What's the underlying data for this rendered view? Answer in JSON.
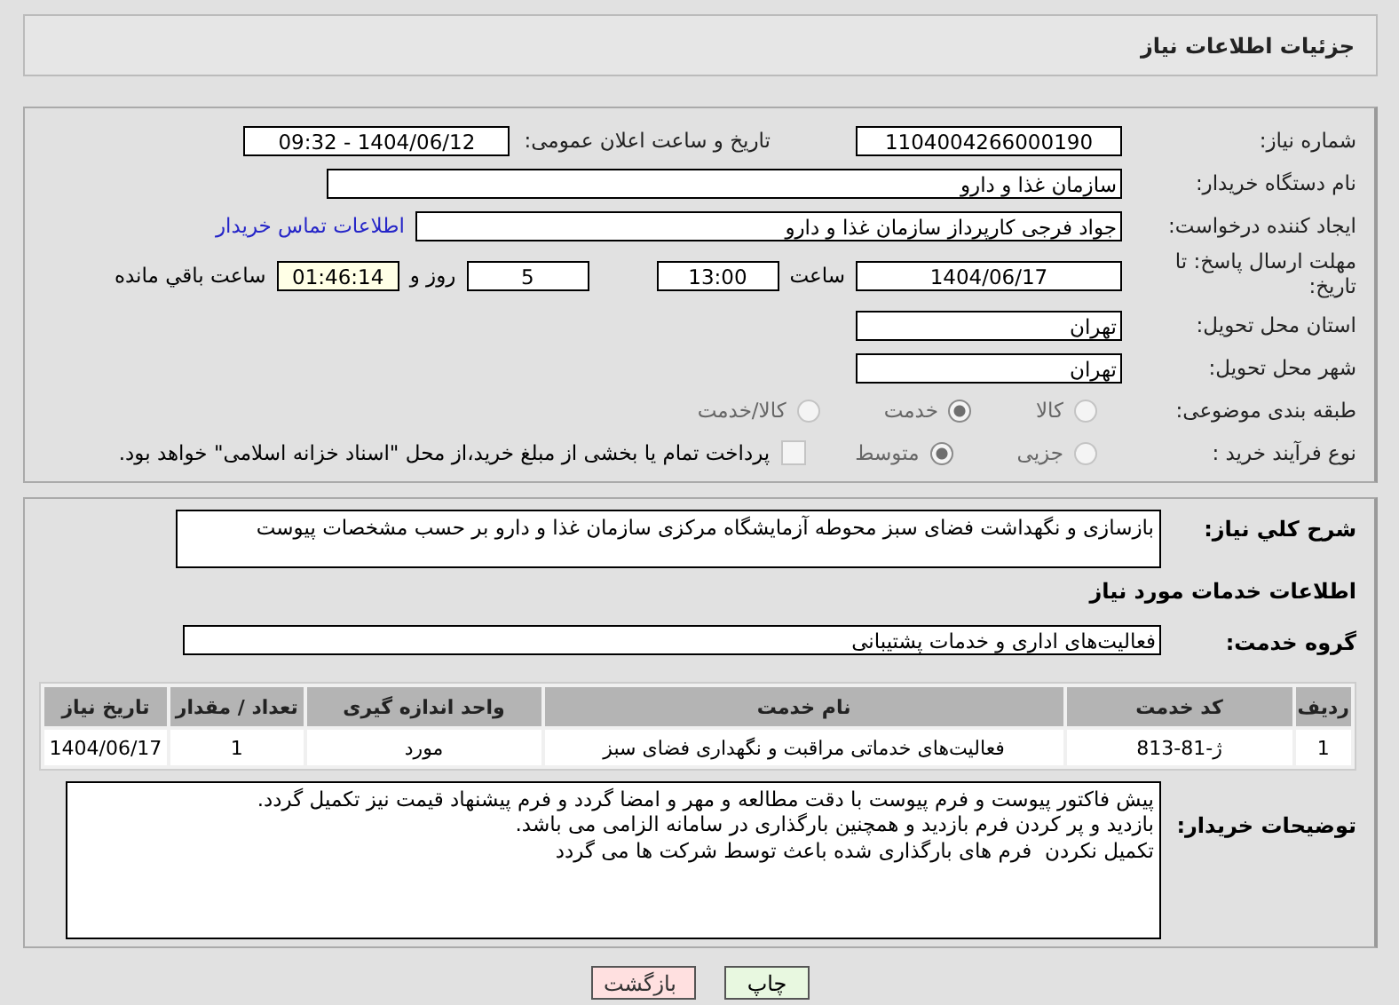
{
  "header": {
    "title": "جزئیات اطلاعات نیاز"
  },
  "details": {
    "need_number": {
      "label": "شماره نیاز:",
      "value": "1104004266000190"
    },
    "announce": {
      "label": "تاریخ و ساعت اعلان عمومی:",
      "value": "1404/06/12 - 09:32"
    },
    "buyer_org": {
      "label": "نام دستگاه خریدار:",
      "value": "سازمان غذا و دارو"
    },
    "requester": {
      "label": "ایجاد کننده درخواست:",
      "value": "جواد فرجی کارپرداز سازمان غذا و دارو"
    },
    "contact_link": "اطلاعات تماس خریدار",
    "deadline": {
      "label": "مهلت ارسال پاسخ: تا تاریخ:",
      "date": "1404/06/17",
      "time_label": "ساعت",
      "time": "13:00",
      "days": "5",
      "days_label": "روز و",
      "remaining": "01:46:14",
      "remaining_label": "ساعت باقي مانده"
    },
    "province": {
      "label": "استان محل تحویل:",
      "value": "تهران"
    },
    "city": {
      "label": "شهر محل تحویل:",
      "value": "تهران"
    },
    "category": {
      "label": "طبقه بندی موضوعی:",
      "options": [
        {
          "label": "کالا",
          "selected": false
        },
        {
          "label": "خدمت",
          "selected": true
        },
        {
          "label": "کالا/خدمت",
          "selected": false
        }
      ]
    },
    "process": {
      "label": "نوع فرآیند خرید :",
      "options": [
        {
          "label": "جزیی",
          "selected": false
        },
        {
          "label": "متوسط",
          "selected": true
        }
      ],
      "payment": {
        "label": "پرداخت تمام یا بخشی از مبلغ خرید،از محل \"اسناد خزانه اسلامی\" خواهد بود.",
        "checked": false
      }
    }
  },
  "summary": {
    "label": "شرح كلي نياز:",
    "value": "بازسازی و نگهداشت فضای سبز محوطه آزمایشگاه مرکزی سازمان غذا و دارو بر حسب مشخصات پیوست"
  },
  "services": {
    "heading": "اطلاعات خدمات مورد نیاز",
    "group_label": "گروه خدمت:",
    "group": "فعالیت‌های اداری و خدمات پشتیبانی",
    "table": {
      "columns": [
        "ردیف",
        "کد خدمت",
        "نام خدمت",
        "واحد اندازه گیری",
        "تعداد / مقدار",
        "تاریخ نیاز"
      ],
      "rows": [
        [
          "1",
          "ژ-81-813",
          "فعالیت‌های خدماتی مراقبت و نگهداری فضای سبز",
          "مورد",
          "1",
          "1404/06/17"
        ]
      ]
    }
  },
  "notes": {
    "label": "توضیحات خریدار:",
    "lines": [
      "پیش فاکتور پیوست و فرم پیوست با دقت مطالعه و مهر و امضا گردد و فرم پیشنهاد قیمت نیز تکمیل گردد.",
      "بازدید و پر کردن فرم بازدید و همچنین بارگذاری در سامانه الزامی می باشد.",
      "تکمیل نکردن  فرم های بارگذاری شده باعث توسط شرکت ها می گردد"
    ]
  },
  "buttons": [
    {
      "label": "چاپ",
      "kind": "print"
    },
    {
      "label": "بازگشت",
      "kind": "back"
    }
  ]
}
